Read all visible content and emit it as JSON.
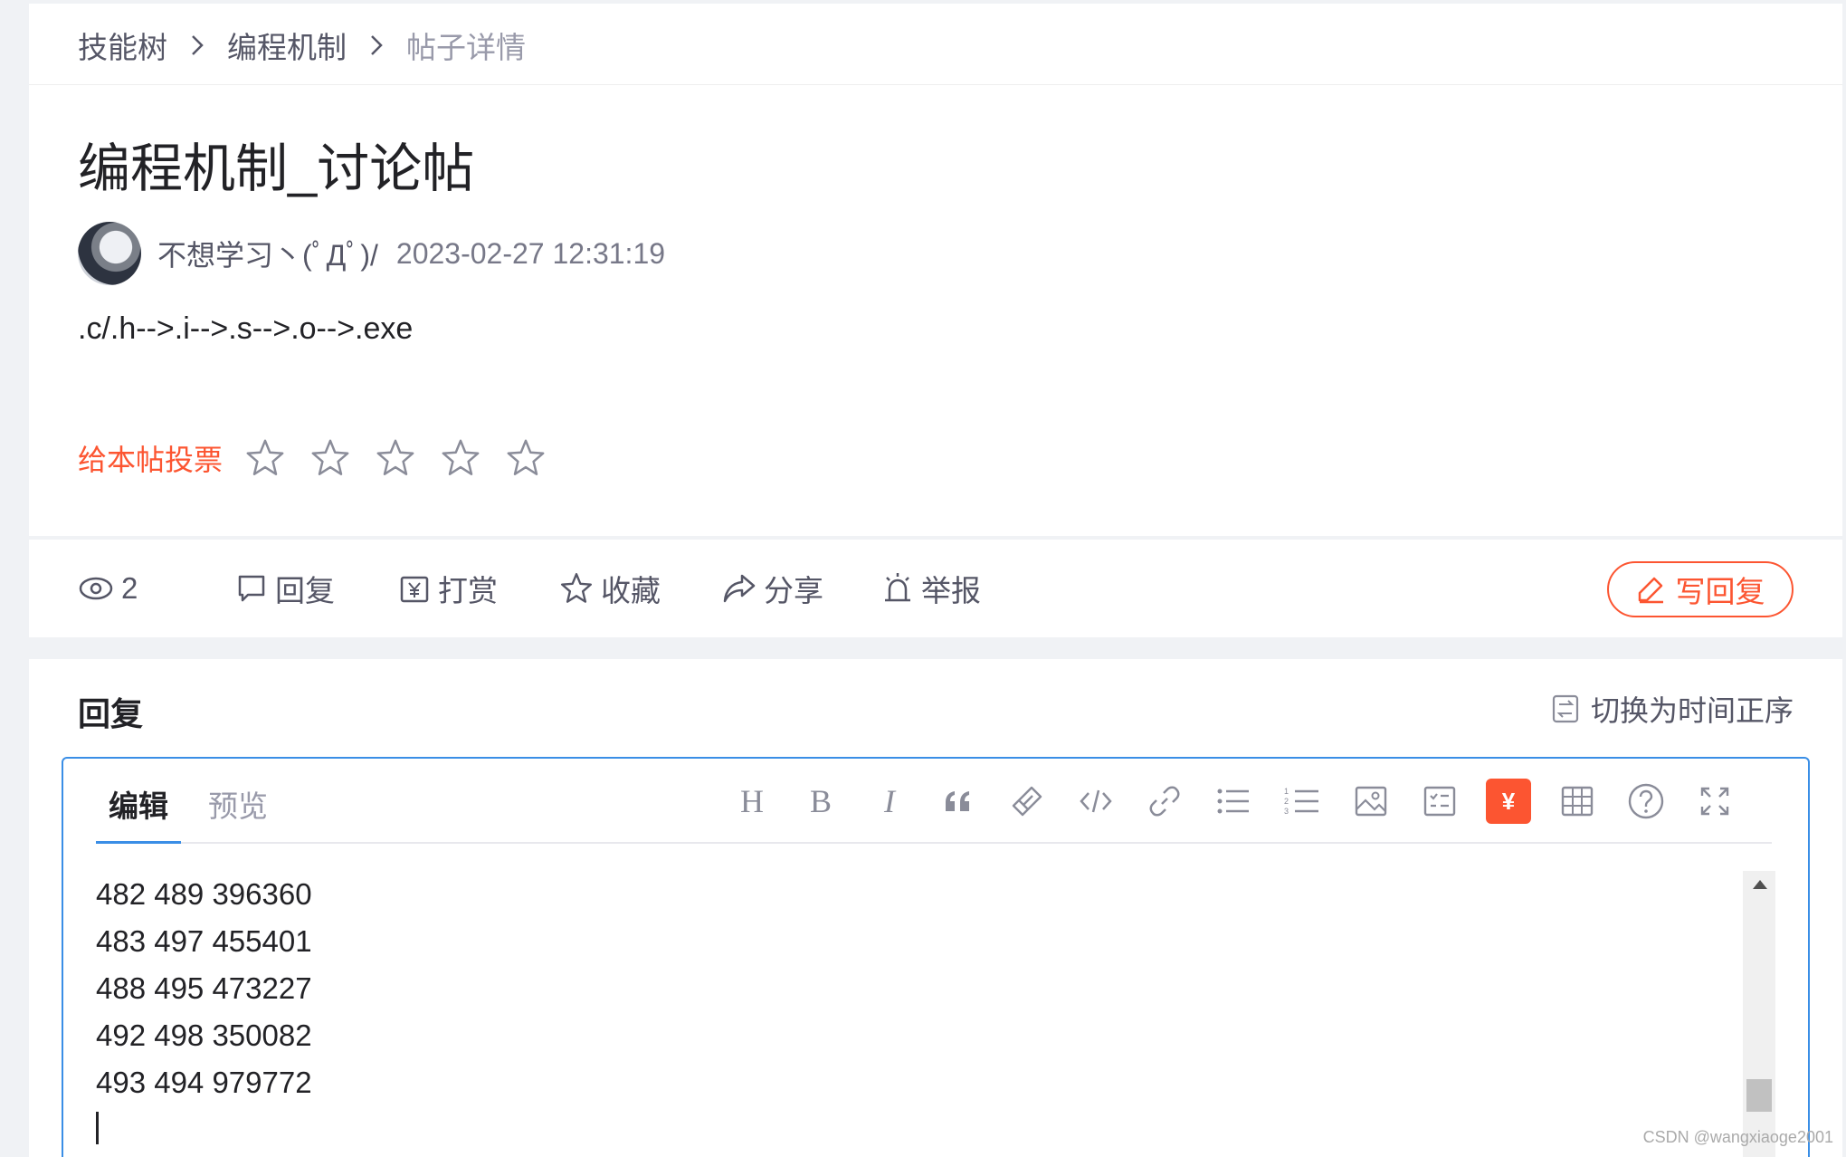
{
  "breadcrumb": {
    "items": [
      "技能树",
      "编程机制",
      "帖子详情"
    ]
  },
  "post": {
    "title": "编程机制_讨论帖",
    "author": "不想学习丶(ﾟДﾟ)/",
    "time": "2023-02-27 12:31:19",
    "body": ".c/.h-->.i-->.s-->.o-->.exe",
    "vote_label": "给本帖投票",
    "rating": 0,
    "rating_max": 5
  },
  "actions": {
    "views": "2",
    "reply": "回复",
    "reward": "打赏",
    "favorite": "收藏",
    "share": "分享",
    "report": "举报",
    "write_reply": "写回复"
  },
  "reply_section": {
    "heading": "回复",
    "sort_toggle": "切换为时间正序"
  },
  "editor": {
    "tabs": [
      "编辑",
      "预览"
    ],
    "active_tab": "编辑",
    "toolbar_icons": [
      "heading-icon",
      "bold-icon",
      "italic-icon",
      "quote-icon",
      "clear-format-icon",
      "code-icon",
      "link-icon",
      "unordered-list-icon",
      "ordered-list-icon",
      "image-icon",
      "checklist-icon",
      "reward-icon",
      "table-icon",
      "help-icon",
      "fullscreen-icon"
    ],
    "toolbar_text": {
      "heading": "H",
      "bold": "B",
      "italic": "I",
      "reward": "¥"
    },
    "lines": [
      "482 489 396360",
      "483 497 455401",
      "488 495 473227",
      "492 498 350082",
      "493 494 979772"
    ]
  },
  "colors": {
    "accent": "#fc5531",
    "link_blue": "#3a8ee6",
    "background": "#f0f2f5"
  },
  "watermark": "CSDN @wangxiaoge2001"
}
